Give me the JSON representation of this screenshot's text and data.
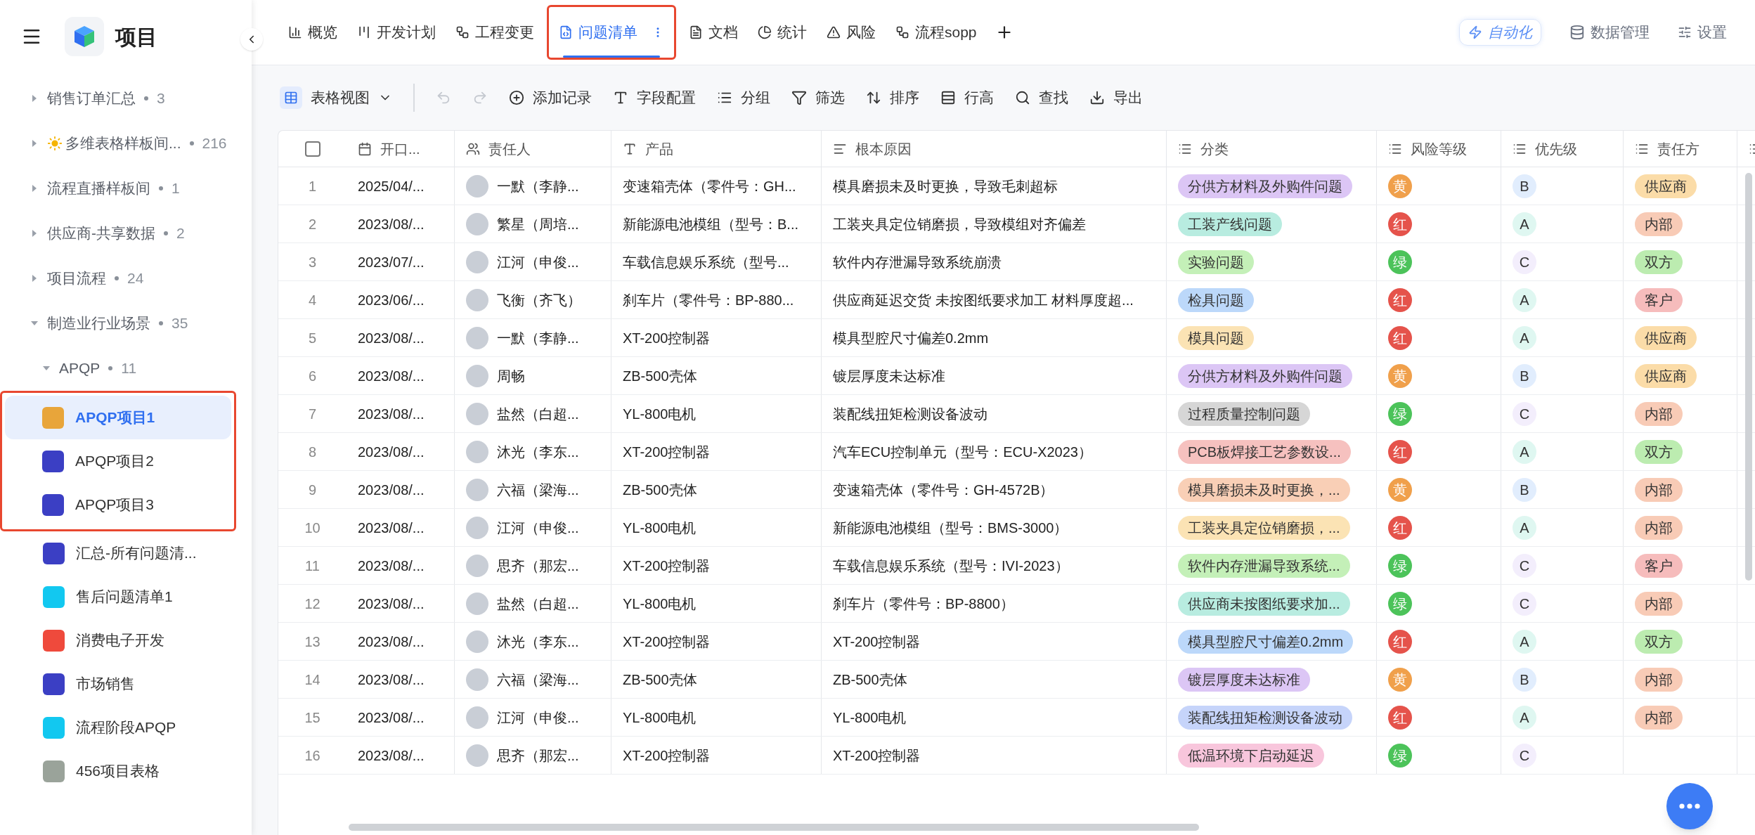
{
  "sidebar": {
    "title": "项目",
    "items": [
      {
        "label": "销售订单汇总",
        "count": "3",
        "expanded": false
      },
      {
        "label": "多维表格样板间...",
        "count": "216",
        "expanded": false,
        "sun_mark": true
      },
      {
        "label": "流程直播样板间",
        "count": "1",
        "expanded": false
      },
      {
        "label": "供应商-共享数据",
        "count": "2",
        "expanded": false
      },
      {
        "label": "项目流程",
        "count": "24",
        "expanded": false
      },
      {
        "label": "制造业行业场景",
        "count": "35",
        "expanded": true,
        "children": [
          {
            "label": "APQP",
            "count": "11",
            "expanded": true,
            "children": [
              {
                "label": "APQP项目1",
                "selected": true,
                "annotated": true,
                "color": "#e8a53a"
              },
              {
                "label": "APQP项目2",
                "selected": false,
                "annotated": true,
                "color": "#3b3fc4"
              },
              {
                "label": "APQP项目3",
                "selected": false,
                "annotated": true,
                "color": "#3b3fc4"
              },
              {
                "label": "汇总-所有问题清...",
                "selected": false,
                "annotated": false,
                "color": "#3b3fc4"
              },
              {
                "label": "售后问题清单1",
                "selected": false,
                "annotated": false,
                "color": "#12c8f0"
              },
              {
                "label": "消费电子开发",
                "selected": false,
                "annotated": false,
                "color": "#ef4a3c"
              },
              {
                "label": "市场销售",
                "selected": false,
                "annotated": false,
                "color": "#3b3fc4"
              },
              {
                "label": "流程阶段APQP",
                "selected": false,
                "annotated": false,
                "color": "#12c8f0"
              },
              {
                "label": "456项目表格",
                "selected": false,
                "annotated": false,
                "color": "#9aa39a"
              }
            ]
          }
        ]
      }
    ]
  },
  "tabs": [
    {
      "label": "概览",
      "selected": false,
      "annotated": false
    },
    {
      "label": "开发计划",
      "selected": false,
      "annotated": false
    },
    {
      "label": "工程变更",
      "selected": false,
      "annotated": false
    },
    {
      "label": "问题清单",
      "selected": true,
      "annotated": true
    },
    {
      "label": "文档",
      "selected": false,
      "annotated": false
    },
    {
      "label": "统计",
      "selected": false,
      "annotated": false
    },
    {
      "label": "风险",
      "selected": false,
      "annotated": false
    },
    {
      "label": "流程sopp",
      "selected": false,
      "annotated": false
    }
  ],
  "top_actions": {
    "automation": "自动化",
    "data": "数据管理",
    "settings": "设置"
  },
  "toolbar": {
    "view": "表格视图",
    "undo": {
      "disabled": true
    },
    "redo": {
      "disabled": true
    },
    "actions": [
      "添加记录",
      "字段配置",
      "分组",
      "筛选",
      "排序",
      "行高",
      "查找",
      "导出"
    ]
  },
  "table": {
    "header_checked": false,
    "columns": [
      {
        "label": "开口...",
        "kind": "date"
      },
      {
        "label": "责任人",
        "kind": "person"
      },
      {
        "label": "产品",
        "kind": "text"
      },
      {
        "label": "根本原因",
        "kind": "longtext"
      },
      {
        "label": "分类",
        "kind": "select"
      },
      {
        "label": "风险等级",
        "kind": "select"
      },
      {
        "label": "优先级",
        "kind": "select"
      },
      {
        "label": "责任方",
        "kind": "select"
      },
      {
        "kind": "select"
      }
    ],
    "rows": [
      {
        "no": "1",
        "date": "2025/04/...",
        "owner": "一默（李静...",
        "product": "变速箱壳体（零件号：GH...",
        "cause": "模具磨损未及时更换，导致毛刺超标",
        "category": {
          "text": "分供方材料及外购件问题",
          "color": "#dcc6f5"
        },
        "risk": {
          "text": "黄",
          "color": "#f0a04b"
        },
        "priority": {
          "text": "B",
          "color": "#e1edfd"
        },
        "party": {
          "text": "供应商",
          "color": "#fbdca8"
        }
      },
      {
        "no": "2",
        "date": "2023/08/...",
        "owner": "繁星（周培...",
        "product": "新能源电池模组（型号：B...",
        "cause": "工装夹具定位销磨损，导致模组对齐偏差",
        "category": {
          "text": "工装产线问题",
          "color": "#b8ece0"
        },
        "risk": {
          "text": "红",
          "color": "#e5534b"
        },
        "priority": {
          "text": "A",
          "color": "#dff7f1"
        },
        "party": {
          "text": "内部",
          "color": "#f8cbb6"
        }
      },
      {
        "no": "3",
        "date": "2023/07/...",
        "owner": "江河（申俊...",
        "product": "车载信息娱乐系统（型号...",
        "cause": "软件内存泄漏导致系统崩溃",
        "category": {
          "text": "实验问题",
          "color": "#c4f0b8"
        },
        "risk": {
          "text": "绿",
          "color": "#4cc35a"
        },
        "priority": {
          "text": "C",
          "color": "#f3eefc"
        },
        "party": {
          "text": "双方",
          "color": "#bcecb0"
        }
      },
      {
        "no": "4",
        "date": "2023/06/...",
        "owner": "飞衡（齐飞）",
        "product": "刹车片（零件号：BP-880...",
        "cause": "供应商延迟交货 未按图纸要求加工 材料厚度超...",
        "category": {
          "text": "检具问题",
          "color": "#bcd8fa"
        },
        "risk": {
          "text": "红",
          "color": "#e5534b"
        },
        "priority": {
          "text": "A",
          "color": "#dff7f1"
        },
        "party": {
          "text": "客户",
          "color": "#f6bcbc"
        }
      },
      {
        "no": "5",
        "date": "2023/08/...",
        "owner": "一默（李静...",
        "product": "XT-200控制器",
        "cause": "模具型腔尺寸偏差0.2mm",
        "category": {
          "text": "模具问题",
          "color": "#fbe3b4"
        },
        "risk": {
          "text": "红",
          "color": "#e5534b"
        },
        "priority": {
          "text": "A",
          "color": "#dff7f1"
        },
        "party": {
          "text": "供应商",
          "color": "#fbdca8"
        }
      },
      {
        "no": "6",
        "date": "2023/08/...",
        "owner": "周畅",
        "product": "ZB-500壳体",
        "cause": "镀层厚度未达标准",
        "category": {
          "text": "分供方材料及外购件问题",
          "color": "#dcc6f5"
        },
        "risk": {
          "text": "黄",
          "color": "#f0a04b"
        },
        "priority": {
          "text": "B",
          "color": "#e1edfd"
        },
        "party": {
          "text": "供应商",
          "color": "#fbdca8"
        }
      },
      {
        "no": "7",
        "date": "2023/08/...",
        "owner": "盐然（白超...",
        "product": "YL-800电机",
        "cause": "装配线扭矩检测设备波动",
        "category": {
          "text": "过程质量控制问题",
          "color": "#d6d6d6"
        },
        "risk": {
          "text": "绿",
          "color": "#4cc35a"
        },
        "priority": {
          "text": "C",
          "color": "#f3eefc"
        },
        "party": {
          "text": "内部",
          "color": "#f8cbb6"
        }
      },
      {
        "no": "8",
        "date": "2023/08/...",
        "owner": "沐光（李东...",
        "product": "XT-200控制器",
        "cause": "汽车ECU控制单元（型号：ECU-X2023）",
        "category": {
          "text": "PCB板焊接工艺参数设...",
          "color": "#f6c1bf"
        },
        "risk": {
          "text": "红",
          "color": "#e5534b"
        },
        "priority": {
          "text": "A",
          "color": "#dff7f1"
        },
        "party": {
          "text": "双方",
          "color": "#bcecb0"
        }
      },
      {
        "no": "9",
        "date": "2023/08/...",
        "owner": "六福（梁海...",
        "product": "ZB-500壳体",
        "cause": "变速箱壳体（零件号：GH-4572B）",
        "category": {
          "text": "模具磨损未及时更换，...",
          "color": "#f9cfb6"
        },
        "risk": {
          "text": "黄",
          "color": "#f0a04b"
        },
        "priority": {
          "text": "B",
          "color": "#e1edfd"
        },
        "party": {
          "text": "内部",
          "color": "#f8cbb6"
        }
      },
      {
        "no": "10",
        "date": "2023/08/...",
        "owner": "江河（申俊...",
        "product": "YL-800电机",
        "cause": "新能源电池模组（型号：BMS-3000）",
        "category": {
          "text": "工装夹具定位销磨损，...",
          "color": "#fbe3b4"
        },
        "risk": {
          "text": "红",
          "color": "#e5534b"
        },
        "priority": {
          "text": "A",
          "color": "#dff7f1"
        },
        "party": {
          "text": "内部",
          "color": "#f8cbb6"
        }
      },
      {
        "no": "11",
        "date": "2023/08/...",
        "owner": "思齐（那宏...",
        "product": "XT-200控制器",
        "cause": "车载信息娱乐系统（型号：IVI-2023）",
        "category": {
          "text": "软件内存泄漏导致系统...",
          "color": "#c4f0b8"
        },
        "risk": {
          "text": "绿",
          "color": "#4cc35a"
        },
        "priority": {
          "text": "C",
          "color": "#f3eefc"
        },
        "party": {
          "text": "客户",
          "color": "#f6bcbc"
        }
      },
      {
        "no": "12",
        "date": "2023/08/...",
        "owner": "盐然（白超...",
        "product": "YL-800电机",
        "cause": "刹车片（零件号：BP-8800）",
        "category": {
          "text": "供应商未按图纸要求加...",
          "color": "#b8ece0"
        },
        "risk": {
          "text": "绿",
          "color": "#4cc35a"
        },
        "priority": {
          "text": "C",
          "color": "#f3eefc"
        },
        "party": {
          "text": "内部",
          "color": "#f8cbb6"
        }
      },
      {
        "no": "13",
        "date": "2023/08/...",
        "owner": "沐光（李东...",
        "product": "XT-200控制器",
        "cause": "XT-200控制器",
        "category": {
          "text": "模具型腔尺寸偏差0.2mm",
          "color": "#bcd8fa"
        },
        "risk": {
          "text": "红",
          "color": "#e5534b"
        },
        "priority": {
          "text": "A",
          "color": "#dff7f1"
        },
        "party": {
          "text": "双方",
          "color": "#bcecb0"
        }
      },
      {
        "no": "14",
        "date": "2023/08/...",
        "owner": "六福（梁海...",
        "product": "ZB-500壳体",
        "cause": "ZB-500壳体",
        "category": {
          "text": "镀层厚度未达标准",
          "color": "#dcc6f5"
        },
        "risk": {
          "text": "黄",
          "color": "#f0a04b"
        },
        "priority": {
          "text": "B",
          "color": "#e1edfd"
        },
        "party": {
          "text": "内部",
          "color": "#f8cbb6"
        }
      },
      {
        "no": "15",
        "date": "2023/08/...",
        "owner": "江河（申俊...",
        "product": "YL-800电机",
        "cause": "YL-800电机",
        "category": {
          "text": "装配线扭矩检测设备波动",
          "color": "#c6d4fa"
        },
        "risk": {
          "text": "红",
          "color": "#e5534b"
        },
        "priority": {
          "text": "A",
          "color": "#dff7f1"
        },
        "party": {
          "text": "内部",
          "color": "#f8cbb6"
        }
      },
      {
        "no": "16",
        "date": "2023/08/...",
        "owner": "思齐（那宏...",
        "product": "XT-200控制器",
        "cause": "XT-200控制器",
        "category": {
          "text": "低温环境下启动延迟",
          "color": "#f8c6dc"
        },
        "risk": {
          "text": "绿",
          "color": "#4cc35a"
        },
        "priority": {
          "text": "C",
          "color": "#f3eefc"
        }
      }
    ]
  }
}
